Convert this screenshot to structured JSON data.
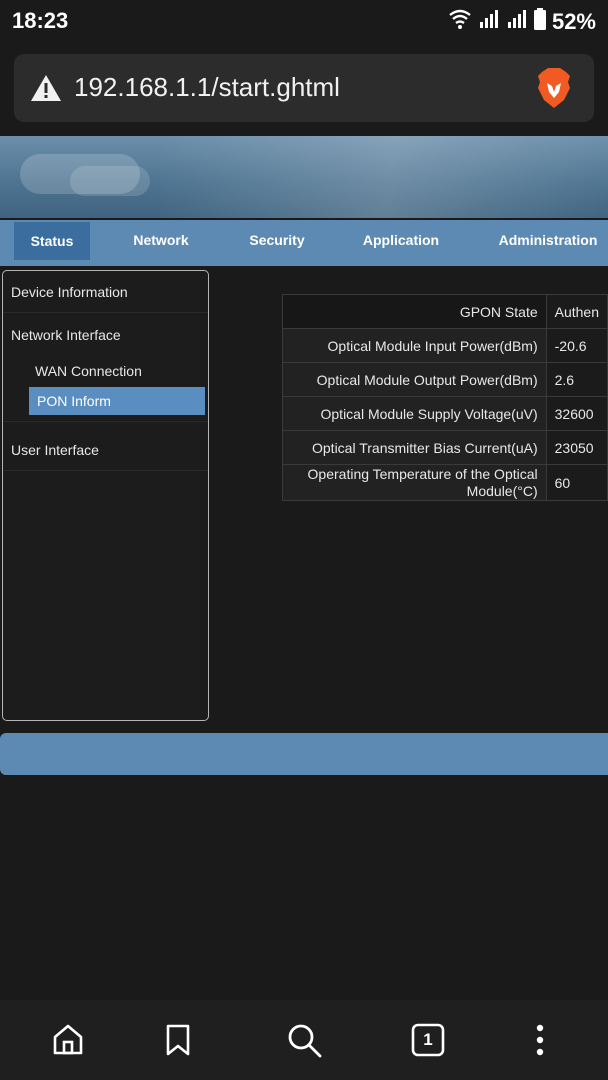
{
  "status_bar": {
    "time": "18:23",
    "battery": "52%"
  },
  "address_bar": {
    "url": "192.168.1.1/start.ghtml"
  },
  "nav": {
    "tabs": [
      {
        "label": "Status"
      },
      {
        "label": "Network"
      },
      {
        "label": "Security"
      },
      {
        "label": "Application"
      },
      {
        "label": "Administration"
      }
    ]
  },
  "sidebar": {
    "device_information": "Device Information",
    "network_interface": "Network Interface",
    "wan_connection": "WAN Connection",
    "pon_inform": "PON Inform",
    "user_interface": "User Interface"
  },
  "pon_table": {
    "rows": [
      {
        "label": "GPON State",
        "value": "Authen"
      },
      {
        "label": "Optical Module Input Power(dBm)",
        "value": "-20.6"
      },
      {
        "label": "Optical Module Output Power(dBm)",
        "value": "2.6"
      },
      {
        "label": "Optical Module Supply Voltage(uV)",
        "value": "32600"
      },
      {
        "label": "Optical Transmitter Bias Current(uA)",
        "value": "23050"
      },
      {
        "label": "Operating Temperature of the Optical Module(°C)",
        "value": "60"
      }
    ]
  },
  "bottom_nav": {
    "tab_count": "1"
  },
  "colors": {
    "nav_bar": "#5d8ab2",
    "nav_active": "#3b6e9e",
    "sidebar_active": "#5a8ec0",
    "brave_orange": "#f15a22"
  }
}
